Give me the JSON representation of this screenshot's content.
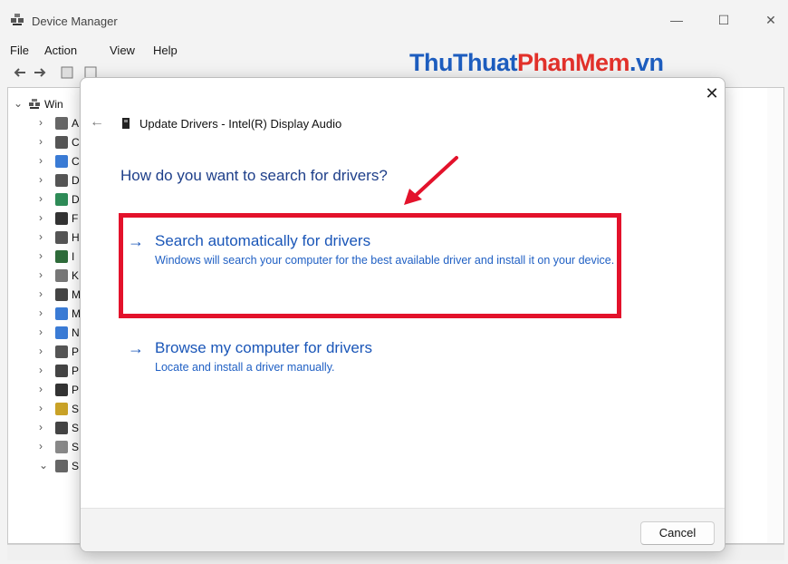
{
  "window": {
    "title": "Device Manager",
    "minimize_glyph": "—",
    "maximize_glyph": "☐",
    "close_glyph": "✕"
  },
  "menu": [
    "File",
    "Action",
    "View",
    "Help"
  ],
  "toolbar_icons": [
    "back-icon",
    "forward-icon",
    "properties-icon",
    "update-driver-icon",
    "help-icon",
    "view-icon",
    "monitor-icon",
    "scan-icon",
    "plug-icon",
    "uninstall-icon",
    "download-icon"
  ],
  "tree": {
    "root_label": "Win",
    "items": [
      {
        "icon": "audio-icon",
        "label": "A",
        "expanded": false
      },
      {
        "icon": "camera-icon",
        "label": "C",
        "expanded": false
      },
      {
        "icon": "computer-icon",
        "label": "C",
        "expanded": false
      },
      {
        "icon": "disk-icon",
        "label": "D",
        "expanded": false
      },
      {
        "icon": "display-icon",
        "label": "D",
        "expanded": false
      },
      {
        "icon": "firmware-icon",
        "label": "F",
        "expanded": false
      },
      {
        "icon": "hid-icon",
        "label": "H",
        "expanded": false
      },
      {
        "icon": "ide-icon",
        "label": "I",
        "expanded": false
      },
      {
        "icon": "keyboard-icon",
        "label": "K",
        "expanded": false
      },
      {
        "icon": "mouse-icon",
        "label": "M",
        "expanded": false
      },
      {
        "icon": "monitor-icon",
        "label": "M",
        "expanded": false
      },
      {
        "icon": "network-icon",
        "label": "N",
        "expanded": false
      },
      {
        "icon": "ports-icon",
        "label": "P",
        "expanded": false
      },
      {
        "icon": "print-icon",
        "label": "P",
        "expanded": false
      },
      {
        "icon": "processor-icon",
        "label": "P",
        "expanded": false
      },
      {
        "icon": "security-icon",
        "label": "S",
        "expanded": false
      },
      {
        "icon": "software-icon",
        "label": "S",
        "expanded": false
      },
      {
        "icon": "storage-icon",
        "label": "S",
        "expanded": false
      },
      {
        "icon": "sound-icon",
        "label": "S",
        "expanded": true
      }
    ]
  },
  "watermark": {
    "part1": "ThuThuat",
    "part2": "PhanMem",
    "part3": ".vn"
  },
  "dialog": {
    "close_glyph": "✕",
    "back_glyph": "←",
    "header": "Update Drivers - Intel(R) Display Audio",
    "question": "How do you want to search for drivers?",
    "options": [
      {
        "arrow": "→",
        "title": "Search automatically for drivers",
        "description": "Windows will search your computer for the best available driver and install it on your device."
      },
      {
        "arrow": "→",
        "title": "Browse my computer for drivers",
        "description": "Locate and install a driver manually."
      }
    ],
    "cancel_label": "Cancel"
  },
  "colors": {
    "accent_link": "#1a56b8",
    "highlight": "#e3122b",
    "watermark_blue": "#1d5dbf",
    "watermark_red": "#e2312a"
  }
}
